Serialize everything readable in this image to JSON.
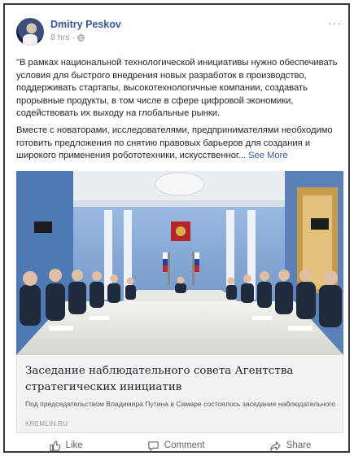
{
  "post": {
    "author": "Dmitry Peskov",
    "time": "8 hrs",
    "dot": "·",
    "paragraph1": "\"В рамках национальной технологической инициативы нужно обеспечивать условия для быстрого внедрения новых разработок в производство, поддерживать стартапы, высокотехнологичные компании, создавать прорывные продукты, в том числе в сфере цифровой экономики, содействовать их выходу на глобальные рынки.",
    "paragraph2": "Вместе с новаторами, исследователями, предпринимателями необходимо готовить предложения по снятию правовых барьеров для создания и широкого применения робототехники, искусственног...",
    "see_more": "See More",
    "more_glyph": "···"
  },
  "link": {
    "headline": "Заседание наблюдательного совета Агентства стратегических инициатив",
    "snippet": "Под председательством Владимира Путина в Самаре состоялось заседание наблюдательного совета автономной некоммерческой организации «Агентство...",
    "domain": "KREMLIN.RU"
  },
  "actions": {
    "like": "Like",
    "comment": "Comment",
    "share": "Share"
  },
  "icons": {
    "globe": "globe-icon",
    "more": "more-options-icon",
    "like": "thumbs-up-icon",
    "comment": "comment-bubble-icon",
    "share": "share-arrow-icon"
  },
  "colors": {
    "name_link": "#365899",
    "meta_gray": "#90949c",
    "caption_bg": "#f2f3f5"
  }
}
